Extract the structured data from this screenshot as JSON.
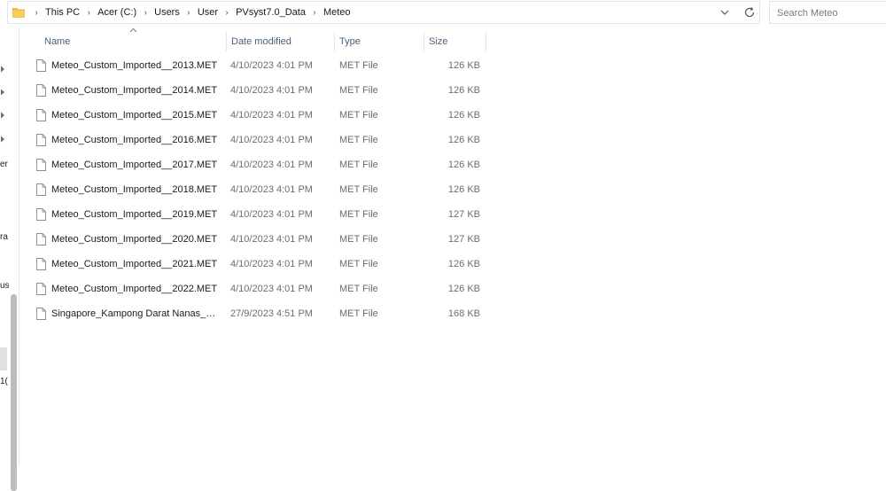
{
  "address": {
    "crumbs": [
      "This PC",
      "Acer (C:)",
      "Users",
      "User",
      "PVsyst7.0_Data",
      "Meteo"
    ]
  },
  "search": {
    "placeholder": "Search Meteo"
  },
  "nav_fragments": [
    "er",
    "ra",
    "us",
    "1("
  ],
  "columns": {
    "name": "Name",
    "date": "Date modified",
    "type": "Type",
    "size": "Size"
  },
  "files": [
    {
      "name": "Meteo_Custom_Imported__2013.MET",
      "date": "4/10/2023 4:01 PM",
      "type": "MET File",
      "size": "126 KB"
    },
    {
      "name": "Meteo_Custom_Imported__2014.MET",
      "date": "4/10/2023 4:01 PM",
      "type": "MET File",
      "size": "126 KB"
    },
    {
      "name": "Meteo_Custom_Imported__2015.MET",
      "date": "4/10/2023 4:01 PM",
      "type": "MET File",
      "size": "126 KB"
    },
    {
      "name": "Meteo_Custom_Imported__2016.MET",
      "date": "4/10/2023 4:01 PM",
      "type": "MET File",
      "size": "126 KB"
    },
    {
      "name": "Meteo_Custom_Imported__2017.MET",
      "date": "4/10/2023 4:01 PM",
      "type": "MET File",
      "size": "126 KB"
    },
    {
      "name": "Meteo_Custom_Imported__2018.MET",
      "date": "4/10/2023 4:01 PM",
      "type": "MET File",
      "size": "126 KB"
    },
    {
      "name": "Meteo_Custom_Imported__2019.MET",
      "date": "4/10/2023 4:01 PM",
      "type": "MET File",
      "size": "127 KB"
    },
    {
      "name": "Meteo_Custom_Imported__2020.MET",
      "date": "4/10/2023 4:01 PM",
      "type": "MET File",
      "size": "127 KB"
    },
    {
      "name": "Meteo_Custom_Imported__2021.MET",
      "date": "4/10/2023 4:01 PM",
      "type": "MET File",
      "size": "126 KB"
    },
    {
      "name": "Meteo_Custom_Imported__2022.MET",
      "date": "4/10/2023 4:01 PM",
      "type": "MET File",
      "size": "126 KB"
    },
    {
      "name": "Singapore_Kampong Darat Nanas_Custo...",
      "date": "27/9/2023 4:51 PM",
      "type": "MET File",
      "size": "168 KB"
    }
  ],
  "icons": {
    "folder": "folder-icon",
    "file": "file-icon",
    "chevron": "chevron-right-icon",
    "dropdown": "chevron-down-icon",
    "refresh": "refresh-icon",
    "sort": "sort-ascending-icon"
  },
  "colors": {
    "folder": "#f0c04a",
    "header_text": "#4c607a",
    "secondary_text": "#6d6d6d"
  }
}
